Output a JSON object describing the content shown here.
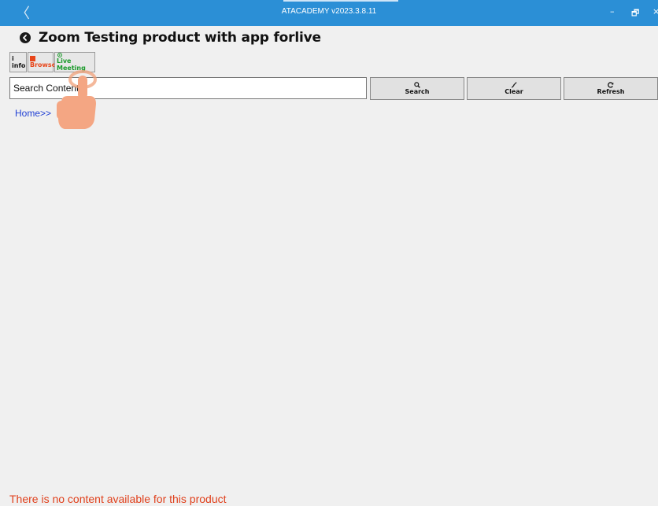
{
  "window": {
    "title": "ATACADEMY v2023.3.8.11",
    "back_glyph": "〈",
    "minimize_glyph": "–",
    "restore_glyph": "🗗",
    "close_glyph": "×"
  },
  "header": {
    "title": "Zoom Testing product with app forlive",
    "back_icon": "back-arrow-circle-icon"
  },
  "toolbar": {
    "info_label": "info",
    "info_icon": "i",
    "browse_label": "Browse",
    "live_label": "Live Meeting"
  },
  "search": {
    "value": "Search Content..."
  },
  "actions": {
    "search_label": "Search",
    "clear_label": "Clear",
    "refresh_label": "Refresh"
  },
  "breadcrumb": "Home>>",
  "empty_message": "There is no content available for this product",
  "colors": {
    "titlebar": "#2b8fd6",
    "browse": "#e8461a",
    "live": "#1a9a2a",
    "link": "#1f3fd4",
    "warning": "#e0401c"
  }
}
